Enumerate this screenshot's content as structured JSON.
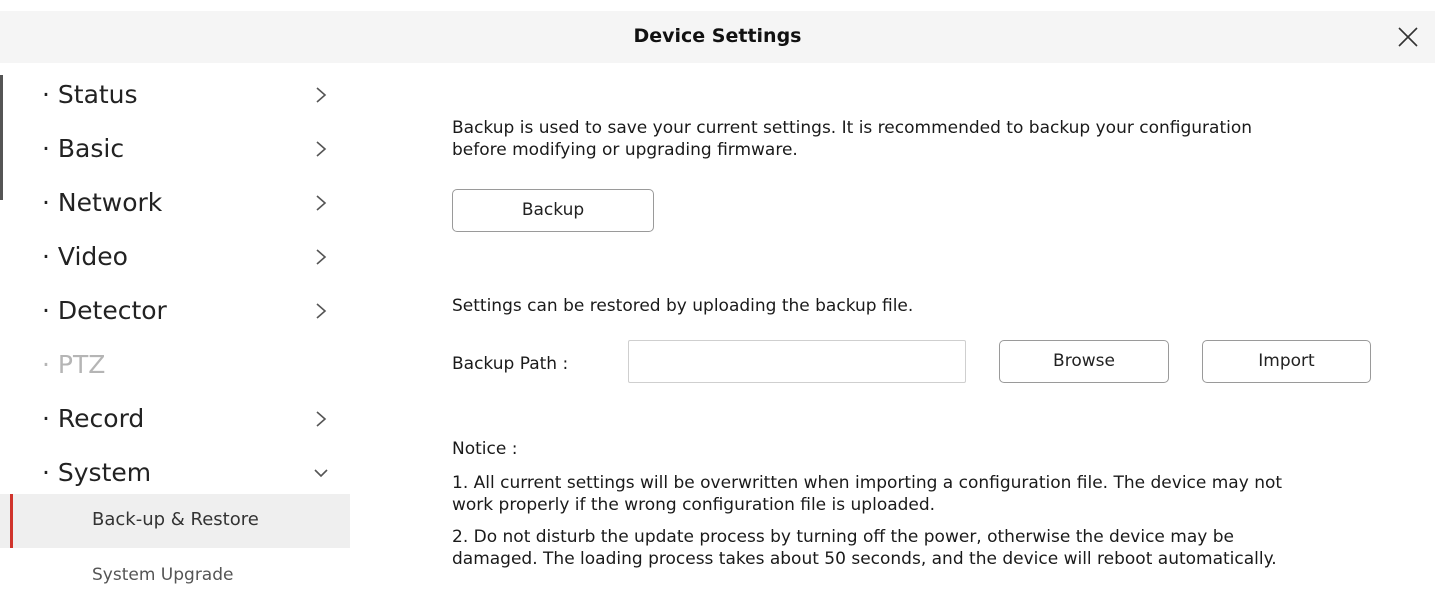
{
  "window": {
    "title": "Device Settings"
  },
  "sidebar": {
    "items": [
      {
        "label": "· Status"
      },
      {
        "label": "· Basic"
      },
      {
        "label": "· Network"
      },
      {
        "label": "· Video"
      },
      {
        "label": "· Detector"
      },
      {
        "label": "· PTZ"
      },
      {
        "label": "· Record"
      },
      {
        "label": "· System"
      }
    ],
    "subitems": [
      {
        "label": "Back-up & Restore"
      },
      {
        "label": "System Upgrade"
      }
    ]
  },
  "main": {
    "backup_text_line1": "Backup is used to save your current settings. It is recommended to backup your configuration",
    "backup_text_line2": "before modifying or upgrading firmware.",
    "backup_button": "Backup",
    "restore_text": "Settings can be restored by uploading the backup file.",
    "backup_path_label": "Backup Path   :",
    "backup_path_value": "",
    "browse_button": "Browse",
    "import_button": "Import",
    "notice_label": "Notice   :",
    "notice1_line1": "1. All current settings will be overwritten when importing a configuration file. The device may not",
    "notice1_line2": "work properly if the wrong configuration file is uploaded.",
    "notice2_line1": "2. Do not disturb the update process by turning off the power, otherwise the device may be",
    "notice2_line2": "damaged. The loading process takes about 50 seconds, and the device will reboot automatically."
  },
  "icons": {
    "close": "close-icon",
    "chevron_right": "chevron-right-icon",
    "chevron_down": "chevron-down-icon"
  },
  "colors": {
    "active_indicator": "#d0342c",
    "active_background": "#efefef",
    "titlebar_background": "#f5f5f5",
    "disabled_text": "#b5b5b5"
  }
}
